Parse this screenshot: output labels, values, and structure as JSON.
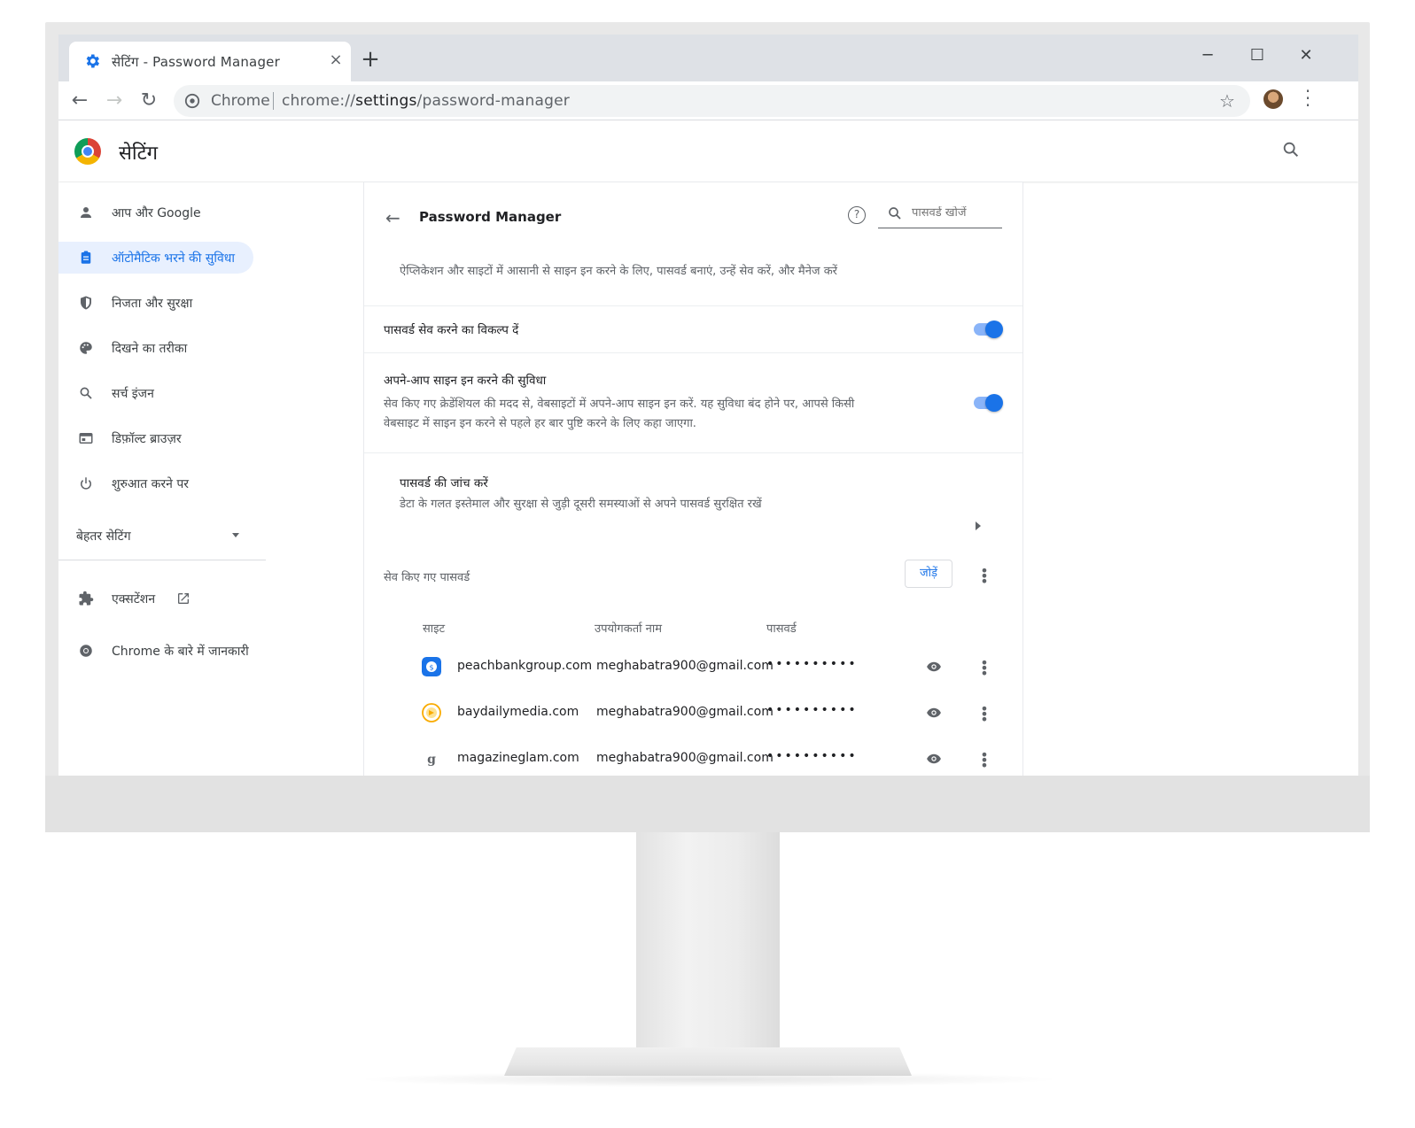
{
  "browser": {
    "tab_title": "सेटिंग - Password Manager",
    "tab_close": "×",
    "new_tab": "+",
    "omnibox_chip": "Chrome",
    "url_prefix": "chrome://",
    "url_path": "settings",
    "url_suffix": "/password-manager"
  },
  "settings": {
    "title": "सेटिंग"
  },
  "sidebar": {
    "items": [
      {
        "label": "आप और Google",
        "icon": "person-icon"
      },
      {
        "label": "ऑटोमैटिक भरने की सुविधा",
        "icon": "clipboard-icon",
        "active": true
      },
      {
        "label": "निजता और सुरक्षा",
        "icon": "shield-icon"
      },
      {
        "label": "दिखने का तरीका",
        "icon": "palette-icon"
      },
      {
        "label": "सर्च इंजन",
        "icon": "search-icon"
      },
      {
        "label": "डिफ़ॉल्ट ब्राउज़र",
        "icon": "browser-icon"
      },
      {
        "label": "शुरुआत करने पर",
        "icon": "power-icon"
      }
    ],
    "advanced": "बेहतर सेटिंग",
    "extensions": "एक्सटेंशन",
    "about": "Chrome के बारे में जानकारी"
  },
  "password_manager": {
    "title": "Password Manager",
    "search_placeholder": "पासवर्ड खोजें",
    "description": "ऐप्लिकेशन और साइटों में आसानी से साइन इन करने के लिए, पासवर्ड बनाएं, उन्हें सेव करें, और मैनेज करें",
    "offer_to_save": {
      "label": "पासवर्ड सेव करने का विकल्प दें",
      "enabled": true
    },
    "auto_signin": {
      "label": "अपने-आप साइन इन करने की सुविधा",
      "sub_line1": "सेव किए गए क्रेडेंशियल की मदद से, वेबसाइटों में अपने-आप साइन इन करें. यह सुविधा बंद होने पर, आपसे किसी",
      "sub_line2": "वेबसाइट में साइन इन करने से पहले हर बार पुष्टि करने के लिए कहा जाएगा.",
      "enabled": true
    },
    "check": {
      "label": "पासवर्ड की जांच करें",
      "sub": "डेटा के गलत इस्तेमाल और सुरक्षा से जुड़ी दूसरी समस्याओं से अपने पासवर्ड सुरक्षित रखें"
    },
    "saved_heading": "सेव किए गए पासवर्ड",
    "add_label": "जोड़ें",
    "columns": {
      "site": "साइट",
      "username": "उपयोगकर्ता नाम",
      "password": "पासवर्ड"
    },
    "entries": [
      {
        "site": "peachbankgroup.com",
        "username": "meghabatra900@gmail.com",
        "password": "••••••••••",
        "favicon_color": "#1a73e8"
      },
      {
        "site": "baydailymedia.com",
        "username": "meghabatra900@gmail.com",
        "password": "••••••••••",
        "favicon_color": "#f9ab00"
      },
      {
        "site": "magazineglam.com",
        "username": "meghabatra900@gmail.com",
        "password": "••••••••••",
        "favicon_color": "#5f6368"
      }
    ]
  }
}
